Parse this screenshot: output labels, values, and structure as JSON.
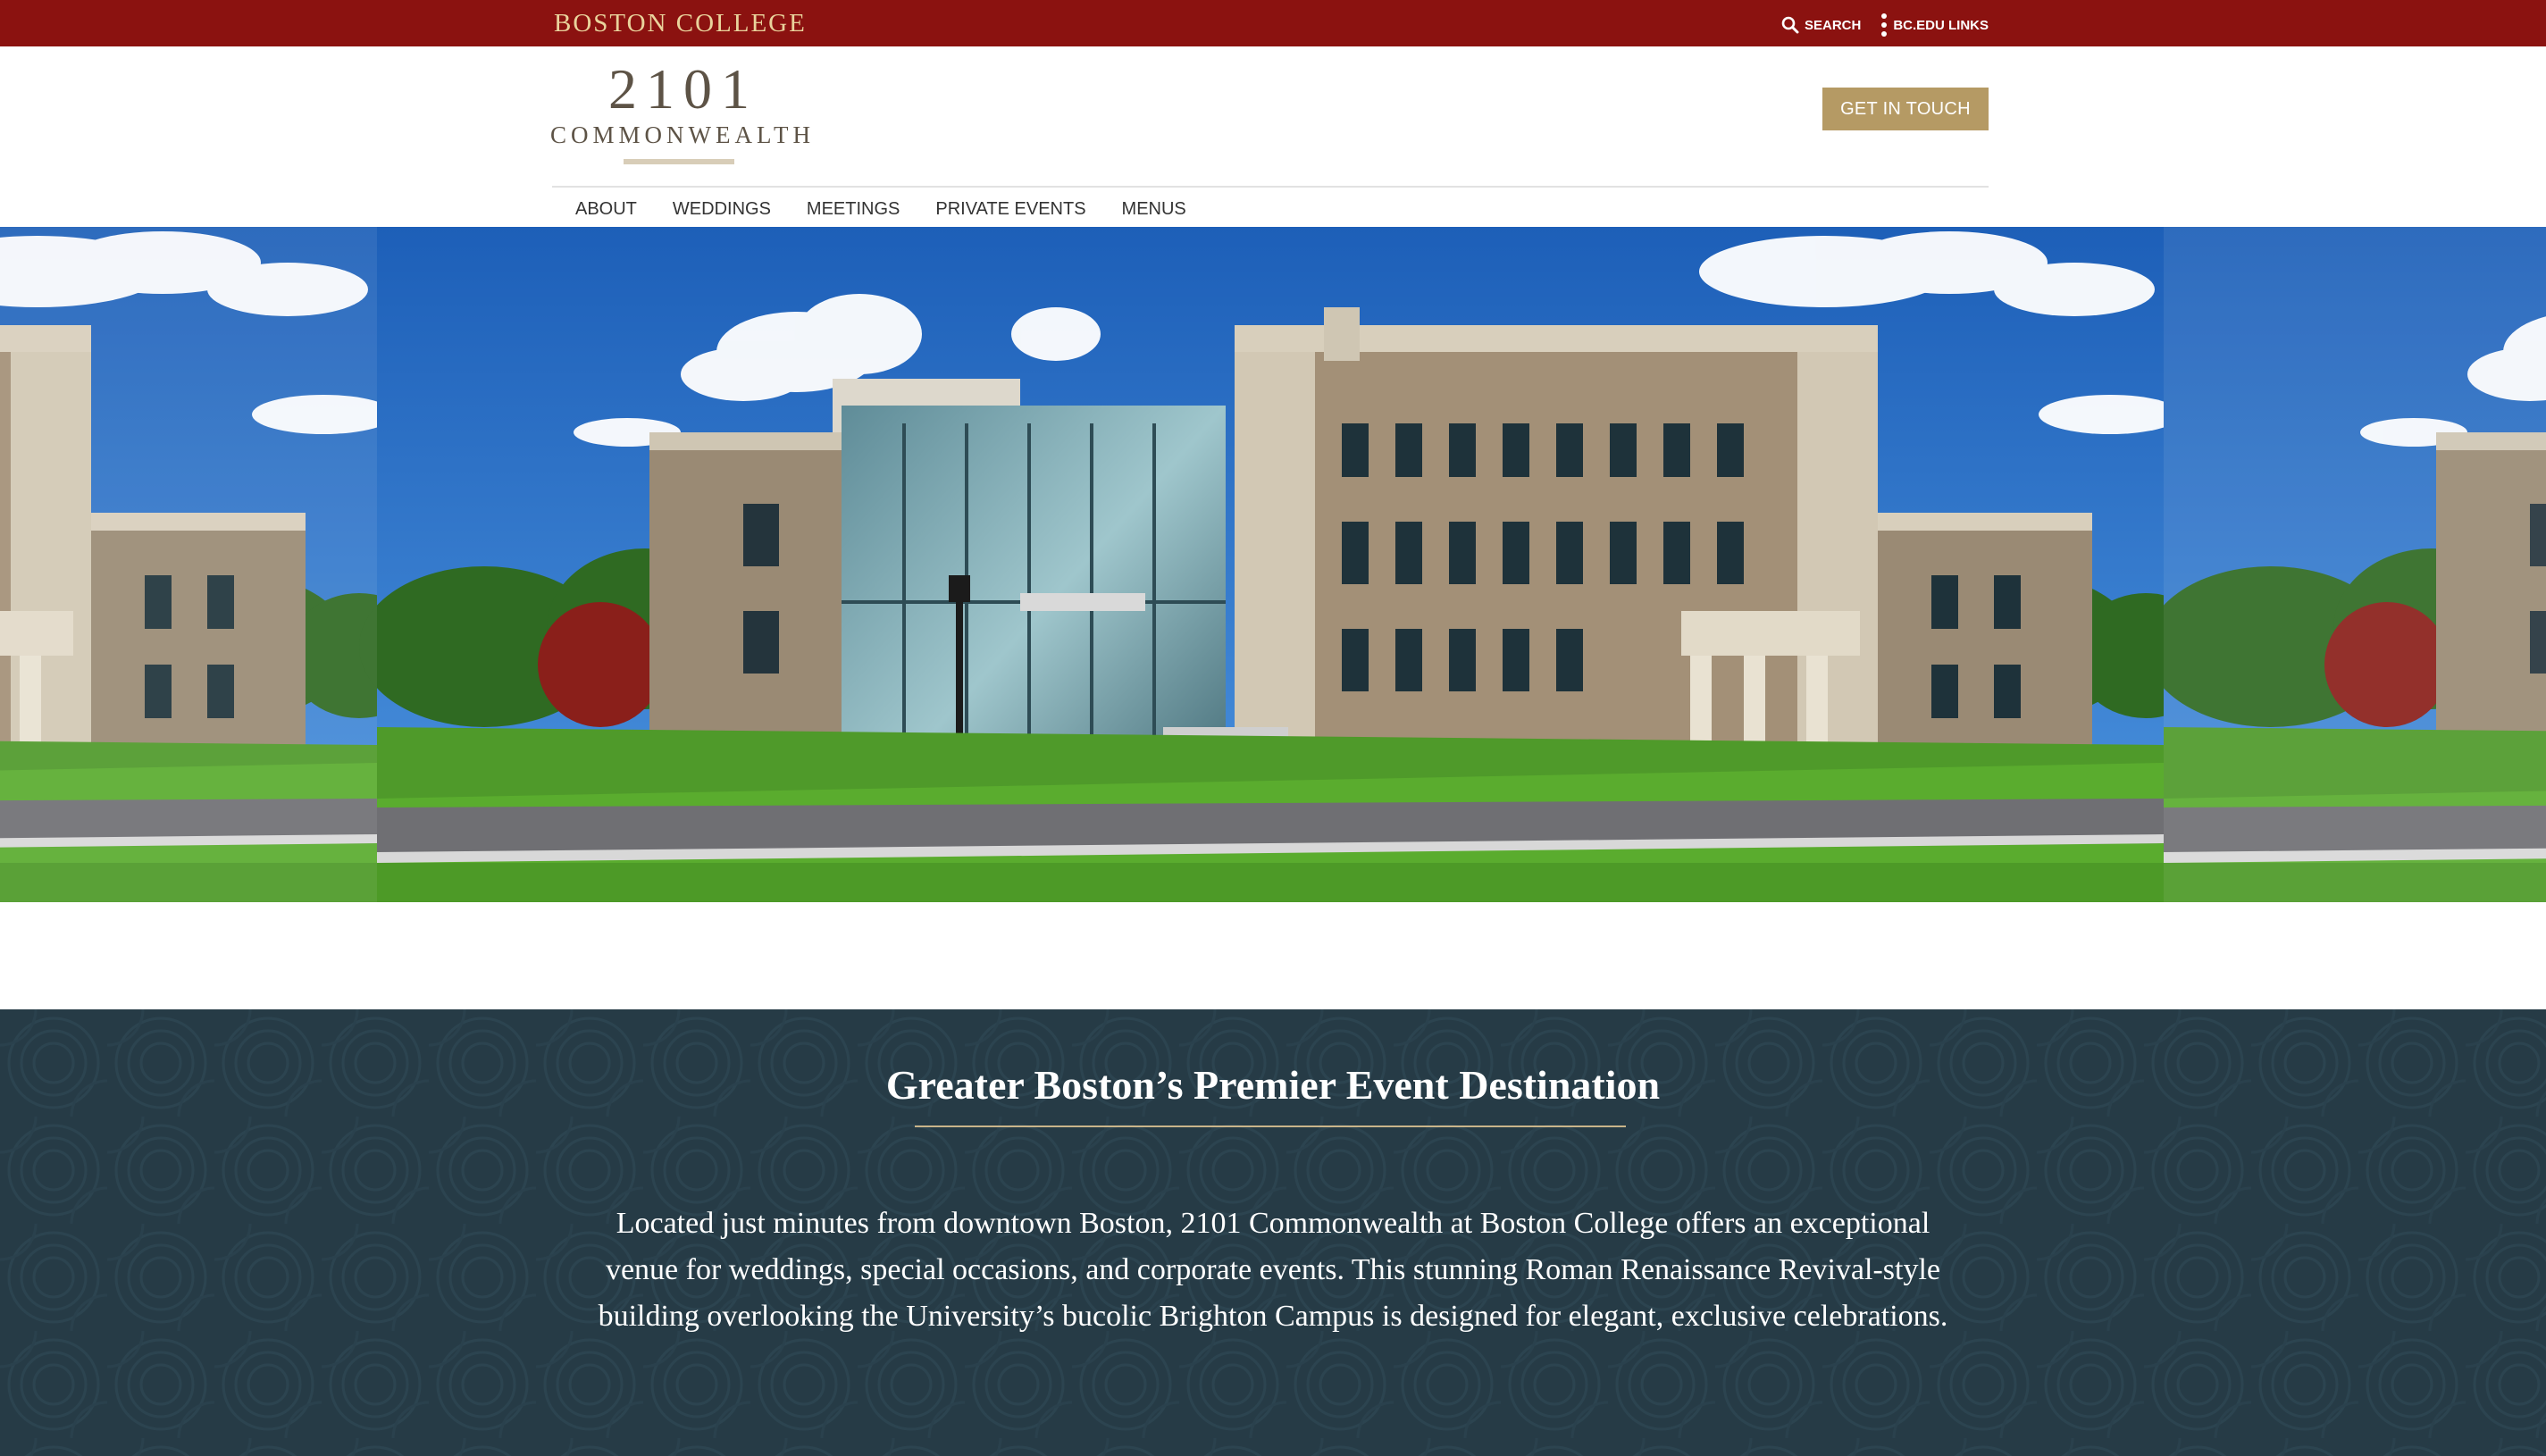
{
  "bc_bar": {
    "wordmark": "BOSTON COLLEGE",
    "search_label": "SEARCH",
    "links_label": "BC.EDU LINKS"
  },
  "header": {
    "logo_number": "2101",
    "logo_word": "COMMONWEALTH",
    "cta_label": "GET IN TOUCH",
    "nav": [
      "ABOUT",
      "WEDDINGS",
      "MEETINGS",
      "PRIVATE EVENTS",
      "MENUS"
    ]
  },
  "hero": {
    "image_subject": "2101 Commonwealth building exterior"
  },
  "intro": {
    "title": "Greater Boston’s Premier Event Destination",
    "body": "Located just minutes from downtown Boston, 2101 Commonwealth at Boston College offers an exceptional venue for weddings, special occasions, and corporate events. This stunning Roman Renaissance Revival-style building overlooking the University’s bucolic Brighton Campus is designed for elegant, exclusive celebrations."
  },
  "colors": {
    "bc_maroon": "#8b1210",
    "gold_accent": "#b59a64",
    "section_slate": "#263b46",
    "logo_text": "#5d5346"
  },
  "icons": {
    "search": "search-icon",
    "links": "vertical-dots-icon"
  }
}
